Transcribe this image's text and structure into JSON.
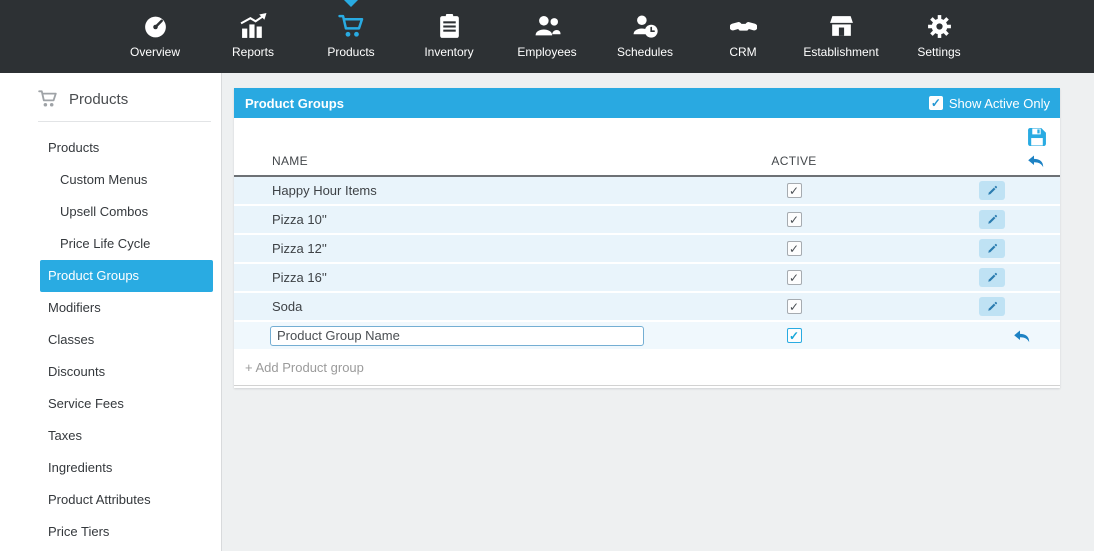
{
  "nav": {
    "items": [
      {
        "label": "Overview",
        "icon": "speedometer-icon",
        "active": false
      },
      {
        "label": "Reports",
        "icon": "bar-chart-icon",
        "active": false
      },
      {
        "label": "Products",
        "icon": "cart-icon",
        "active": true
      },
      {
        "label": "Inventory",
        "icon": "clipboard-icon",
        "active": false
      },
      {
        "label": "Employees",
        "icon": "people-icon",
        "active": false
      },
      {
        "label": "Schedules",
        "icon": "person-clock-icon",
        "active": false
      },
      {
        "label": "CRM",
        "icon": "handshake-icon",
        "active": false
      },
      {
        "label": "Establishment",
        "icon": "store-icon",
        "active": false
      },
      {
        "label": "Settings",
        "icon": "gear-icon",
        "active": false
      }
    ]
  },
  "sidebar": {
    "title": "Products",
    "items": [
      {
        "label": "Products",
        "indent": false,
        "active": false
      },
      {
        "label": "Custom Menus",
        "indent": true,
        "active": false
      },
      {
        "label": "Upsell Combos",
        "indent": true,
        "active": false
      },
      {
        "label": "Price Life Cycle",
        "indent": true,
        "active": false
      },
      {
        "label": "Product Groups",
        "indent": false,
        "active": true
      },
      {
        "label": "Modifiers",
        "indent": false,
        "active": false
      },
      {
        "label": "Classes",
        "indent": false,
        "active": false
      },
      {
        "label": "Discounts",
        "indent": false,
        "active": false
      },
      {
        "label": "Service Fees",
        "indent": false,
        "active": false
      },
      {
        "label": "Taxes",
        "indent": false,
        "active": false
      },
      {
        "label": "Ingredients",
        "indent": false,
        "active": false
      },
      {
        "label": "Product Attributes",
        "indent": false,
        "active": false
      },
      {
        "label": "Price Tiers",
        "indent": false,
        "active": false
      }
    ]
  },
  "panel": {
    "title": "Product Groups",
    "show_active_only_label": "Show Active Only",
    "show_active_only_checked": true
  },
  "table": {
    "headers": {
      "name": "NAME",
      "active": "ACTIVE"
    },
    "rows": [
      {
        "name": "Happy Hour Items",
        "active": true
      },
      {
        "name": "Pizza 10''",
        "active": true
      },
      {
        "name": "Pizza 12''",
        "active": true
      },
      {
        "name": "Pizza 16''",
        "active": true
      },
      {
        "name": "Soda",
        "active": true
      }
    ],
    "new_row": {
      "value": "Product Group Name",
      "active": true
    },
    "add_link": "+ Add Product group"
  },
  "icons": {
    "check": "✓"
  },
  "colors": {
    "accent": "#29abe2",
    "navbar_bg": "#2d3134",
    "row_bg": "#e9f4fb",
    "panel_header_bg": "#29a9e1"
  }
}
